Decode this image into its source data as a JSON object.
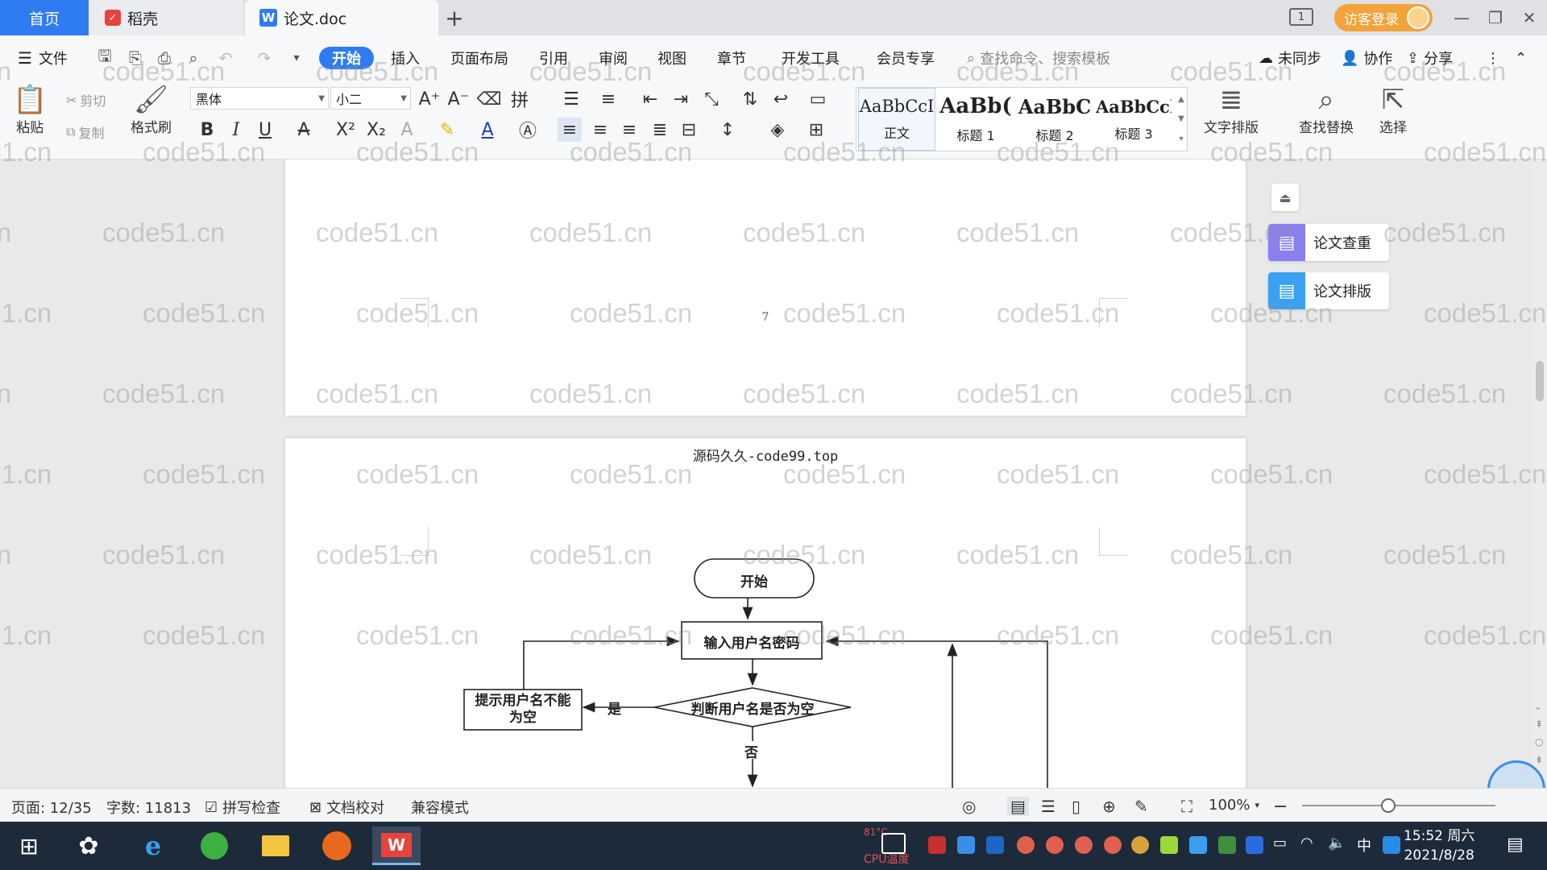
{
  "tabs": {
    "home": "首页",
    "daoke": "稻壳",
    "doc": "论文.doc",
    "add": "+"
  },
  "titlebar": {
    "login": "访客登录",
    "page_indicator": "1"
  },
  "menu": {
    "file": "文件",
    "items": [
      "开始",
      "插入",
      "页面布局",
      "引用",
      "审阅",
      "视图",
      "章节",
      "开发工具",
      "会员专享"
    ],
    "search_placeholder": "查找命令、搜索模板",
    "sync": "未同步",
    "collab": "协作",
    "share": "分享"
  },
  "ribbon": {
    "paste": "粘贴",
    "cut": "剪切",
    "copy": "复制",
    "format_painter": "格式刷",
    "font_name": "黑体",
    "font_size": "小二",
    "styles": [
      {
        "preview": "AaBbCcI",
        "label": "正文"
      },
      {
        "preview": "AaBb(",
        "label": "标题 1"
      },
      {
        "preview": "AaBbC",
        "label": "标题 2"
      },
      {
        "preview": "AaBbCcl",
        "label": "标题 3"
      }
    ],
    "text_layout": "文字排版",
    "find_replace": "查找替换",
    "select": "选择"
  },
  "document": {
    "page_number": "7",
    "header_text": "源码久久-code99.top",
    "watermark": "code51.cn",
    "flowchart": {
      "start": "开始",
      "input": "输入用户名密码",
      "decision": "判断用户名是否为空",
      "prompt": "提示用户名不能为空",
      "yes": "是",
      "no": "否"
    }
  },
  "side_panel": {
    "check": "论文查重",
    "layout": "论文排版"
  },
  "status": {
    "page": "页面: 12/35",
    "words": "字数: 11813",
    "spell": "拼写检查",
    "proof": "文档校对",
    "compat": "兼容模式",
    "zoom": "100%"
  },
  "taskbar": {
    "time": "15:52 周六",
    "date": "2021/8/28",
    "cpu_temp": "81°C",
    "cpu_label": "CPU温度",
    "ime": "中"
  }
}
